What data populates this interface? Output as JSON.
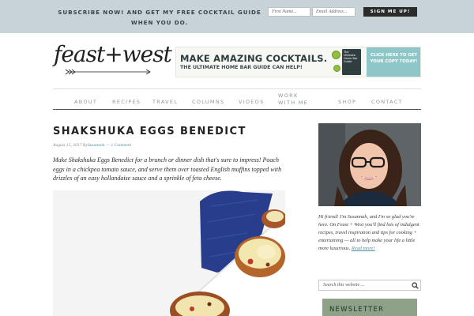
{
  "topbar": {
    "message": "SUBSCRIBE NOW! AND GET MY FREE COCKTAIL GUIDE WHEN YOU DO.",
    "first_name_placeholder": "First Name...",
    "email_placeholder": "Email Address...",
    "signup_label": "SIGN ME UP!"
  },
  "header": {
    "logo_text": "feast+west",
    "banner": {
      "title": "MAKE AMAZING COCKTAILS.",
      "subtitle": "THE ULTIMATE HOME BAR GUIDE CAN HELP!",
      "cta": "CLICK HERE TO GET YOUR COPY TODAY!",
      "book_label": "The Ultimate Home Bar Guide"
    }
  },
  "nav": {
    "items": [
      {
        "label": "ABOUT"
      },
      {
        "label": "RECIPES"
      },
      {
        "label": "TRAVEL"
      },
      {
        "label": "COLUMNS"
      },
      {
        "label": "VIDEOS"
      },
      {
        "label": "WORK WITH ME"
      },
      {
        "label": "SHOP"
      },
      {
        "label": "CONTACT"
      }
    ]
  },
  "post": {
    "title": "SHAKSHUKA EGGS BENEDICT",
    "date": "August 15, 2017",
    "author_prefix": "By",
    "author": "Susannah",
    "separator": "—",
    "comments": "1 Comment",
    "excerpt": "Make Shakshuka Eggs Benedict for a brunch or dinner dish that's sure to impress! Poach eggs in a chickpea tomato sauce, and serve them over toasted English muffins topped with drizzles of an easy hollandaise sauce and a sprinkle of feta cheese."
  },
  "sidebar": {
    "bio": "Hi friend! I'm Susannah, and I'm so glad you're here. On Feast + West you'll find lots of indulgent recipes, travel inspiration and tips for cooking + entertaining — all to help make your life a little more luxurious.",
    "read_more": "Read more!",
    "search_placeholder": "Search this website ...",
    "newsletter_label": "NEWSLETTER"
  },
  "colors": {
    "topbar_bg": "#c8d3d8",
    "accent_link": "#4f8fa0",
    "banner_cta": "#8fc6c7",
    "newsletter_bg": "#8ea28a"
  },
  "icons": {
    "search": "search-icon",
    "logo_arrow": "arrow-icon"
  }
}
